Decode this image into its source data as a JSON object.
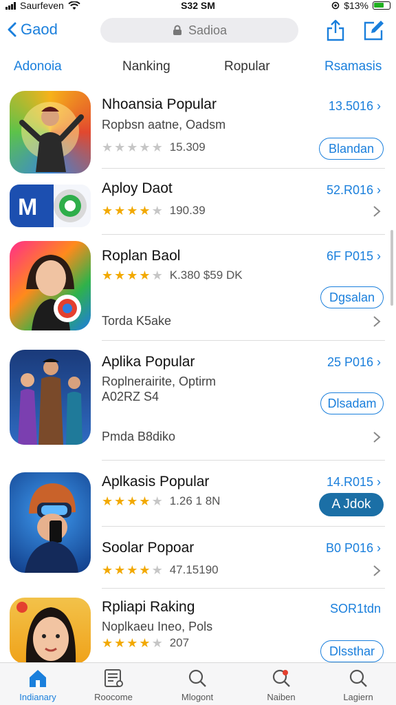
{
  "status_bar": {
    "carrier": "Saurfeven",
    "time": "S32 SM",
    "battery": "$13%"
  },
  "nav": {
    "back_label": "Gaod",
    "search_placeholder": "Sadioa"
  },
  "tabs": [
    "Adonoia",
    "Nanking",
    "Ropular",
    "Rsamasis"
  ],
  "apps": [
    {
      "title": "Nhoansia Popular",
      "subtitle": "Ropbsn aatne, Oadsm",
      "price": "13.5016",
      "rating": 0,
      "meta": "15.309",
      "button": "Blandan"
    },
    {
      "title": "Aploy Daot",
      "price": "52.R016",
      "rating": 4,
      "meta": "190.39"
    },
    {
      "title": "Roplan Baol",
      "price": "6F P015",
      "rating": 4,
      "meta": "K.380  $59 DK",
      "button": "Dgsalan",
      "footer": "Torda K5ake"
    },
    {
      "title": "Aplika Popular",
      "subtitle": "Roplnerairite, Optirm",
      "subtitle2": "A02RZ S4",
      "price": "25 P016",
      "button": "Dlsadam",
      "footer": "Pmda B8diko"
    },
    {
      "title": "Aplkasis Popular",
      "price": "14.R015",
      "rating": 4,
      "meta": "1.26 1 8N",
      "button": "A Jdok"
    },
    {
      "title": "Soolar Popoar",
      "price": "B0 P016",
      "rating": 4,
      "meta": "47.15190"
    },
    {
      "title": "Rpliapi Raking",
      "subtitle": "Noplkaeu Ineo, Pols",
      "price": "SOR1tdn",
      "rating": 4,
      "meta": "207",
      "button": "Dlssthar"
    }
  ],
  "tabbar": [
    {
      "label": "Indianary",
      "icon": "home-icon"
    },
    {
      "label": "Roocome",
      "icon": "news-icon"
    },
    {
      "label": "Mlogont",
      "icon": "search-icon"
    },
    {
      "label": "Naiben",
      "icon": "search-notification-icon"
    },
    {
      "label": "Lagiern",
      "icon": "search-icon"
    }
  ],
  "colors": {
    "accent": "#1a7fdc",
    "star": "#f2a900",
    "filled_button": "#1b6fa6"
  }
}
